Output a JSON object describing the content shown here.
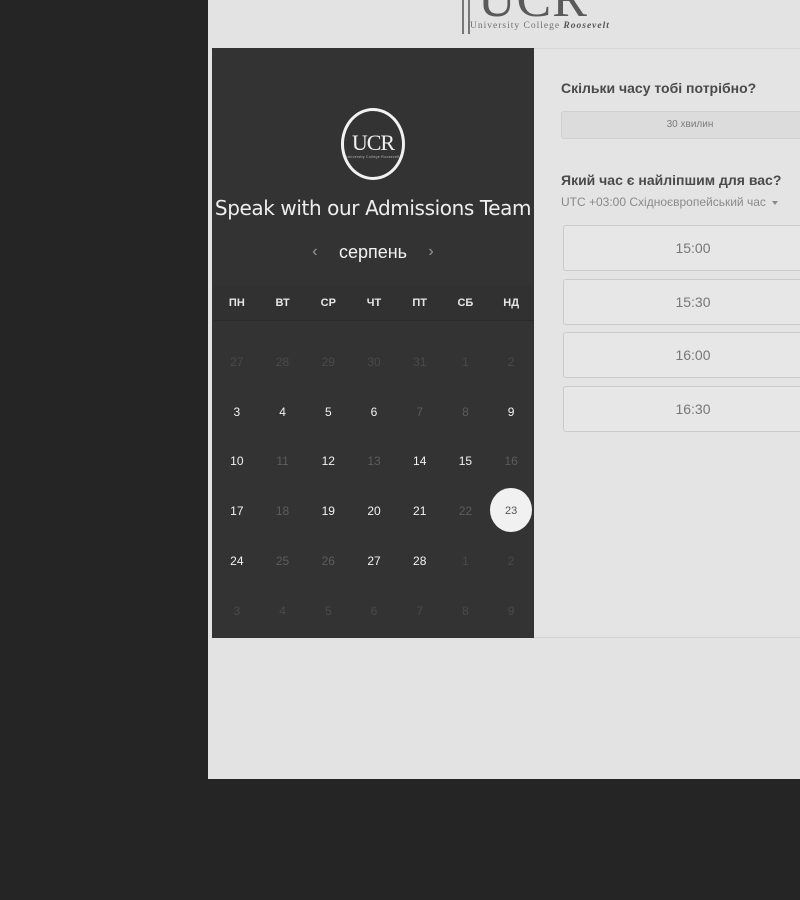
{
  "header": {
    "logo_text": "UCR",
    "logo_subtitle_prefix": "University College",
    "logo_subtitle_name": "Roosevelt"
  },
  "calendar": {
    "logo_text": "UCR",
    "logo_subtitle": "University College Roosevelt",
    "title": "Speak with our Admissions Team",
    "month": "серпень",
    "prev_icon": "‹",
    "next_icon": "›",
    "weekdays": [
      "ПН",
      "ВТ",
      "СР",
      "ЧТ",
      "ПТ",
      "СБ",
      "НД"
    ],
    "days": [
      {
        "d": "27",
        "s": "dim"
      },
      {
        "d": "28",
        "s": "dim"
      },
      {
        "d": "29",
        "s": "dim"
      },
      {
        "d": "30",
        "s": "dim"
      },
      {
        "d": "31",
        "s": "dim"
      },
      {
        "d": "1",
        "s": "dim"
      },
      {
        "d": "2",
        "s": "dim"
      },
      {
        "d": "3",
        "s": "on"
      },
      {
        "d": "4",
        "s": "on"
      },
      {
        "d": "5",
        "s": "on"
      },
      {
        "d": "6",
        "s": "on"
      },
      {
        "d": "7",
        "s": "off"
      },
      {
        "d": "8",
        "s": "off"
      },
      {
        "d": "9",
        "s": "on"
      },
      {
        "d": "10",
        "s": "on"
      },
      {
        "d": "11",
        "s": "off"
      },
      {
        "d": "12",
        "s": "on"
      },
      {
        "d": "13",
        "s": "off"
      },
      {
        "d": "14",
        "s": "on"
      },
      {
        "d": "15",
        "s": "on"
      },
      {
        "d": "16",
        "s": "off"
      },
      {
        "d": "17",
        "s": "on"
      },
      {
        "d": "18",
        "s": "off"
      },
      {
        "d": "19",
        "s": "on"
      },
      {
        "d": "20",
        "s": "on"
      },
      {
        "d": "21",
        "s": "on"
      },
      {
        "d": "22",
        "s": "off"
      },
      {
        "d": "23",
        "s": "sel"
      },
      {
        "d": "24",
        "s": "on"
      },
      {
        "d": "25",
        "s": "off"
      },
      {
        "d": "26",
        "s": "off"
      },
      {
        "d": "27",
        "s": "on"
      },
      {
        "d": "28",
        "s": "on"
      },
      {
        "d": "1",
        "s": "dim"
      },
      {
        "d": "2",
        "s": "dim"
      },
      {
        "d": "3",
        "s": "dim"
      },
      {
        "d": "4",
        "s": "dim"
      },
      {
        "d": "5",
        "s": "dim"
      },
      {
        "d": "6",
        "s": "dim"
      },
      {
        "d": "7",
        "s": "dim"
      },
      {
        "d": "8",
        "s": "dim"
      },
      {
        "d": "9",
        "s": "dim"
      }
    ]
  },
  "booking": {
    "duration_question": "Скільки часу тобі потрібно?",
    "duration_value": "30 хвилин",
    "time_question": "Який час є найліпшим для вас?",
    "timezone": "UTC +03:00 Східноєвропейський час",
    "slots": [
      "15:00",
      "15:30",
      "16:00",
      "16:30"
    ]
  }
}
